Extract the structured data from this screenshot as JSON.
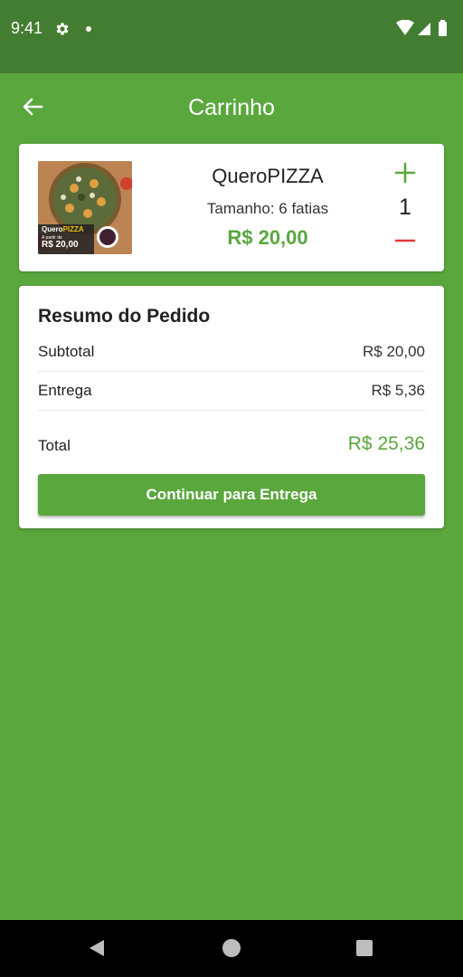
{
  "status_bar": {
    "time": "9:41"
  },
  "app_bar": {
    "title": "Carrinho",
    "back_icon": "arrow-back-icon"
  },
  "cart_item": {
    "name": "QueroPIZZA",
    "size": "Tamanho: 6 fatias",
    "price": "R$ 20,00",
    "quantity": "1",
    "image": {
      "brand_prefix": "Quero",
      "brand_suffix": "PIZZA",
      "tagline": "A partir de",
      "price": "R$ 20,00"
    }
  },
  "summary": {
    "title": "Resumo do Pedido",
    "subtotal_label": "Subtotal",
    "subtotal_value": "R$ 20,00",
    "delivery_label": "Entrega",
    "delivery_value": "R$ 5,36",
    "total_label": "Total",
    "total_value": "R$ 25,36",
    "continue_label": "Continuar para Entrega"
  },
  "colors": {
    "primary": "#5aa73e",
    "status_bar": "#437d31",
    "plus": "#5aa73e",
    "minus": "#e53935"
  }
}
